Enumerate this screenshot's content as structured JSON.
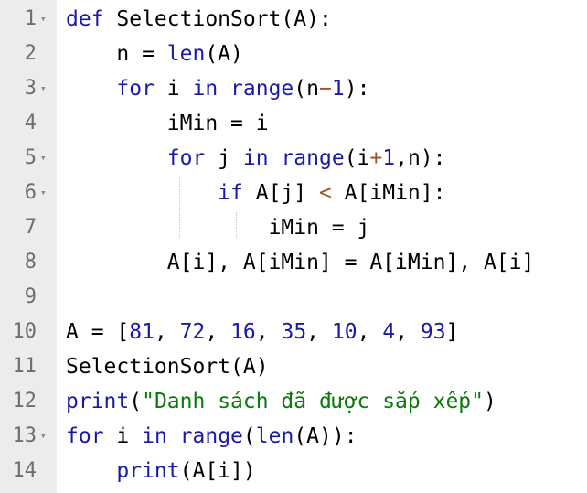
{
  "colors": {
    "keyword": "#1a1aa6",
    "number": "#1a1aa6",
    "string": "#0a7a0a",
    "gutter_bg": "#ececec",
    "line_number": "#6e6e6e"
  },
  "gutter": {
    "line_numbers": [
      "1",
      "2",
      "3",
      "4",
      "5",
      "6",
      "7",
      "8",
      "9",
      "10",
      "11",
      "12",
      "13",
      "14"
    ],
    "fold_marker": "▾",
    "folded_lines": [
      1,
      3,
      5,
      6,
      13
    ]
  },
  "code": {
    "l1": {
      "kw_def": "def",
      "rest": " SelectionSort(A):"
    },
    "l2": {
      "indent": "    ",
      "t1": "n = ",
      "fn": "len",
      "t2": "(A)"
    },
    "l3": {
      "indent": "    ",
      "kw_for": "for",
      "t1": " i ",
      "kw_in": "in",
      "t2": " ",
      "fn": "range",
      "t3": "(n",
      "op": "−",
      "num": "1",
      "t4": "):"
    },
    "l4": {
      "indent": "        ",
      "t1": "iMin = i"
    },
    "l5": {
      "indent": "        ",
      "kw_for": "for",
      "t1": " j ",
      "kw_in": "in",
      "t2": " ",
      "fn": "range",
      "t3": "(i",
      "op": "+",
      "num": "1",
      "t4": ",n):"
    },
    "l6": {
      "indent": "            ",
      "kw_if": "if",
      "t1": " A[j] ",
      "op": "<",
      "t2": " A[iMin]:"
    },
    "l7": {
      "indent": "                ",
      "t1": "iMin = j"
    },
    "l8": {
      "indent": "        ",
      "t1": "A[i], A[iMin] = A[iMin], A[i]"
    },
    "l9": {
      "text": ""
    },
    "l10": {
      "t1": "A = [",
      "n1": "81",
      "c1": ", ",
      "n2": "72",
      "c2": ", ",
      "n3": "16",
      "c3": ", ",
      "n4": "35",
      "c4": ", ",
      "n5": "10",
      "c5": ", ",
      "n6": "4",
      "c6": ", ",
      "n7": "93",
      "t2": "]"
    },
    "l11": {
      "t1": "SelectionSort(A)"
    },
    "l12": {
      "fn": "print",
      "t1": "(",
      "str": "\"Danh sách đã được sắp xếp\"",
      "t2": ")"
    },
    "l13": {
      "kw_for": "for",
      "t1": " i ",
      "kw_in": "in",
      "t2": " ",
      "fn": "range",
      "t3": "(",
      "fn2": "len",
      "t4": "(A)):"
    },
    "l14": {
      "indent": "    ",
      "fn": "print",
      "t1": "(A[i])"
    }
  }
}
